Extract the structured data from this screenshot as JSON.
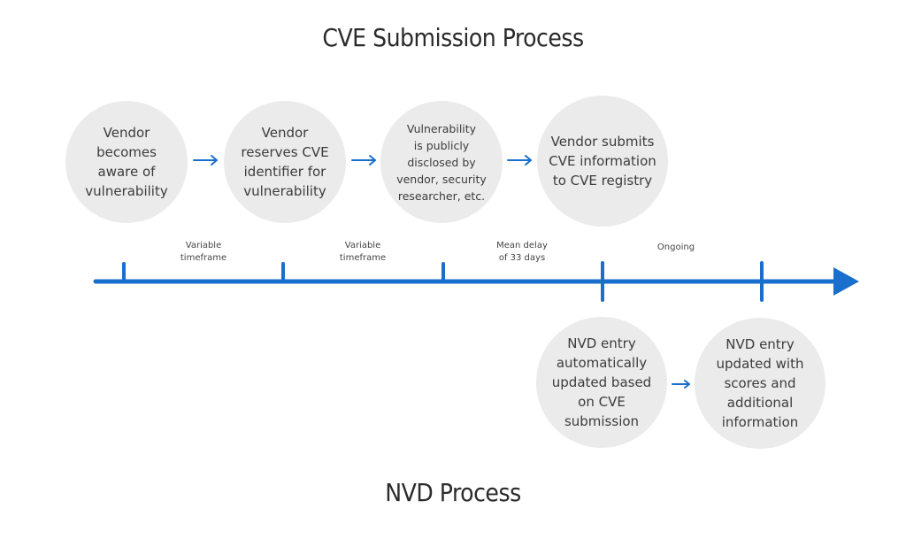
{
  "titles": {
    "top": "CVE Submission Process",
    "bottom": "NVD Process"
  },
  "colors": {
    "accent": "#1a6fcc",
    "circle_fill": "#ebebeb",
    "text": "#3c3c3c",
    "title_text": "#2b2b2b"
  },
  "cve_steps": [
    {
      "text": "Vendor\nbecomes\naware of\nvulnerability"
    },
    {
      "text": "Vendor\nreserves CVE\nidentifier for\nvulnerability"
    },
    {
      "text": "Vulnerability\nis publicly\ndisclosed by\nvendor, security\nresearcher, etc."
    },
    {
      "text": "Vendor submits\nCVE information\nto CVE registry"
    }
  ],
  "nvd_steps": [
    {
      "text": "NVD entry\nautomatically\nupdated based\non CVE\nsubmission"
    },
    {
      "text": "NVD entry\nupdated with\nscores and\nadditional\ninformation"
    }
  ],
  "timeline_labels": [
    {
      "text": "Variable\ntimeframe"
    },
    {
      "text": "Variable\ntimeframe"
    },
    {
      "text": "Mean delay\nof 33 days"
    },
    {
      "text": "Ongoing"
    }
  ],
  "icons": {
    "step_arrow": "right-arrow-icon",
    "timeline_arrowhead": "triangle-right-icon"
  }
}
